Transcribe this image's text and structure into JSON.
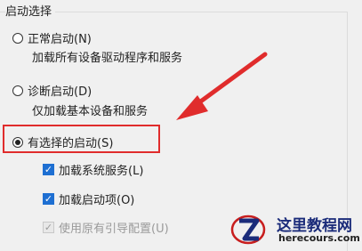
{
  "group": {
    "title": "启动选择"
  },
  "options": {
    "normal": {
      "label": "正常启动(N)",
      "description": "加载所有设备驱动程序和服务"
    },
    "diagnostic": {
      "label": "诊断启动(D)",
      "description": "仅加载基本设备和服务"
    },
    "selective": {
      "label": "有选择的启动(S)"
    }
  },
  "checks": {
    "load_services": "加载系统服务(L)",
    "load_startup": "加载启动项(O)",
    "use_original": "使用原有引导配置(U)"
  },
  "watermark": {
    "title": "这里教程网",
    "url": "herecours.com"
  },
  "colors": {
    "highlight": "#e02c2c",
    "arrow": "#e02c2c",
    "checkbox": "#1e6fd2"
  }
}
